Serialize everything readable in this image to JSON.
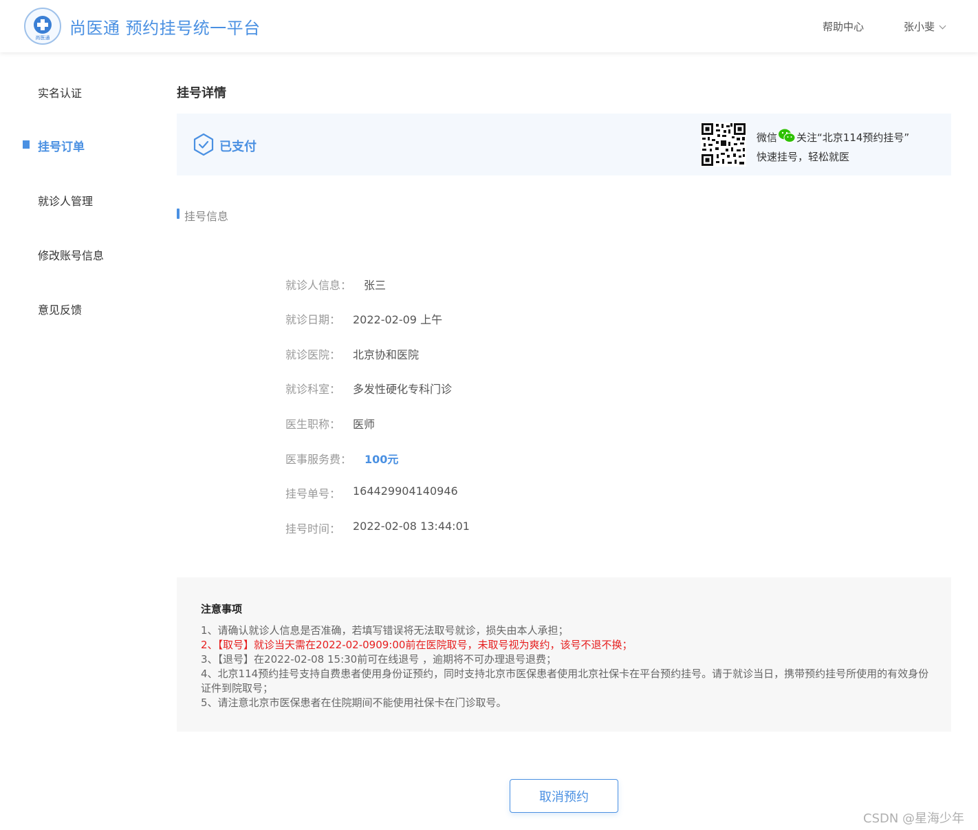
{
  "header": {
    "logo_text": "尚医通",
    "title": "尚医通 预约挂号统一平台",
    "help": "帮助中心",
    "user": "张小斐"
  },
  "sidebar": {
    "items": [
      {
        "label": "实名认证"
      },
      {
        "label": "挂号订单"
      },
      {
        "label": "就诊人管理"
      },
      {
        "label": "修改账号信息"
      },
      {
        "label": "意见反馈"
      }
    ]
  },
  "main": {
    "title": "挂号详情",
    "status": "已支付",
    "follow_prefix": "微信",
    "follow_suffix": "关注“北京114预约挂号”",
    "follow_line2": "快速挂号，轻松就医",
    "section_title": "挂号信息",
    "info": [
      {
        "label": "就诊人信息：",
        "value": "张三"
      },
      {
        "label": "就诊日期：",
        "value": "2022-02-09 上午"
      },
      {
        "label": "就诊医院：",
        "value": "北京协和医院"
      },
      {
        "label": "就诊科室：",
        "value": "多发性硬化专科门诊"
      },
      {
        "label": "医生职称：",
        "value": "医师"
      },
      {
        "label": "医事服务费：",
        "value": "100元"
      },
      {
        "label": "挂号单号：",
        "value": "164429904140946"
      },
      {
        "label": "挂号时间：",
        "value": "2022-02-08 13:44:01"
      }
    ],
    "notice": {
      "title": "注意事项",
      "items": [
        "1、请确认就诊人信息是否准确，若填写错误将无法取号就诊，损失由本人承担；",
        "2、【取号】就诊当天需在2022-02-0909:00前在医院取号，未取号视为爽约，该号不退不换；",
        "3、【退号】在2022-02-08 15:30前可在线退号 ，逾期将不可办理退号退费；",
        "4、北京114预约挂号支持自费患者使用身份证预约，同时支持北京市医保患者使用北京社保卡在平台预约挂号。请于就诊当日，携带预约挂号所使用的有效身份证件到院取号；",
        "5、请注意北京市医保患者在住院期间不能使用社保卡在门诊取号。"
      ]
    },
    "cancel_button": "取消预约"
  },
  "watermark": "CSDN @星海少年",
  "colors": {
    "accent": "#4a90e2",
    "warning": "#e61e1e",
    "wechat": "#2dc100"
  }
}
